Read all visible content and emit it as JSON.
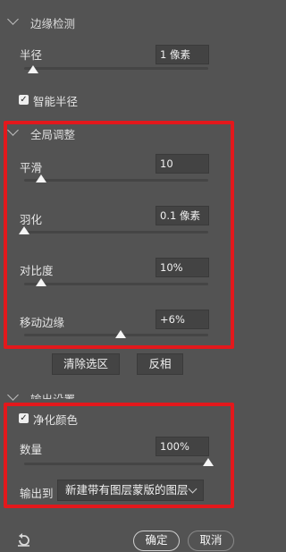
{
  "edge_detection": {
    "section_title": "边缘检测",
    "radius_label": "半径",
    "radius_value": "1 像素",
    "radius_level": 0.07,
    "smart_radius_label": "智能半径",
    "smart_radius_checked": true
  },
  "global_refine": {
    "section_title": "全局调整",
    "smooth_label": "平滑",
    "smooth_value": "10",
    "feather_label": "羽化",
    "feather_value": "0.1 像素",
    "contrast_label": "对比度",
    "contrast_value": "10%",
    "shift_edge_label": "移动边缘",
    "shift_edge_value": "+6%",
    "clear_selection_label": "清除选区",
    "invert_label": "反相"
  },
  "output": {
    "section_title": "输出设置",
    "decontaminate_label": "净化颜色",
    "decontaminate_checked": true,
    "amount_label": "数量",
    "amount_value": "100%",
    "output_to_label": "输出到",
    "output_to_selected": "新建带有图层蒙版的图层"
  },
  "footer": {
    "ok_label": "确定",
    "cancel_label": "取消"
  },
  "colors": {
    "highlight": "#e3181c",
    "panel": "#535353"
  },
  "icons": {
    "reset": "reset-arrow-icon"
  }
}
